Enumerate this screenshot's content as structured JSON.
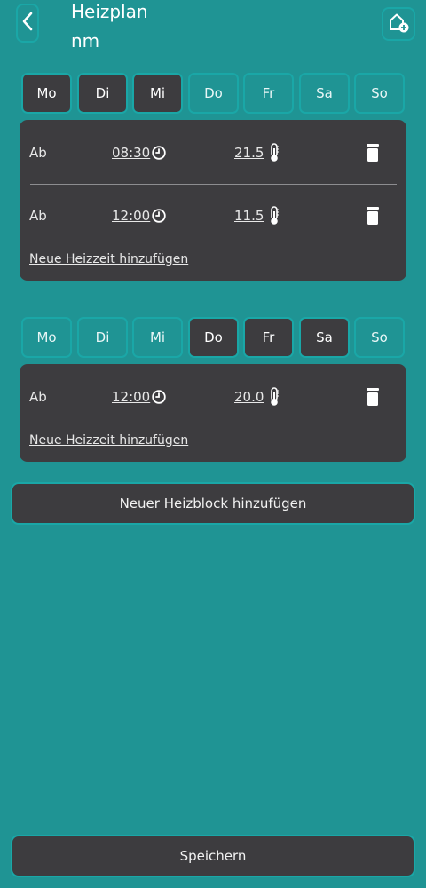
{
  "header": {
    "title": "Heizplan",
    "subtitle": "nm"
  },
  "block1": {
    "days": [
      {
        "label": "Mo",
        "selected": true
      },
      {
        "label": "Di",
        "selected": true
      },
      {
        "label": "Mi",
        "selected": true
      },
      {
        "label": "Do",
        "selected": false
      },
      {
        "label": "Fr",
        "selected": false
      },
      {
        "label": "Sa",
        "selected": false
      },
      {
        "label": "So",
        "selected": false
      }
    ],
    "entries": [
      {
        "prefix": "Ab",
        "time": "08:30",
        "temp": "21.5"
      },
      {
        "prefix": "Ab",
        "time": "12:00",
        "temp": "11.5"
      }
    ],
    "add_label": "Neue Heizzeit hinzufügen"
  },
  "block2": {
    "days": [
      {
        "label": "Mo",
        "selected": false
      },
      {
        "label": "Di",
        "selected": false
      },
      {
        "label": "Mi",
        "selected": false
      },
      {
        "label": "Do",
        "selected": true
      },
      {
        "label": "Fr",
        "selected": true
      },
      {
        "label": "Sa",
        "selected": true
      },
      {
        "label": "So",
        "selected": false
      }
    ],
    "entries": [
      {
        "prefix": "Ab",
        "time": "12:00",
        "temp": "20.0"
      }
    ],
    "add_label": "Neue Heizzeit hinzufügen"
  },
  "add_block_label": "Neuer Heizblock hinzufügen",
  "save_label": "Speichern",
  "icons": {
    "back": "chevron-left-icon",
    "home_add": "home-add-icon",
    "clock": "clock-icon",
    "thermometer": "thermometer-icon",
    "trash": "trash-icon"
  },
  "colors": {
    "background": "#1f9494",
    "card": "#3d3c3f",
    "accent_border": "#1aa7a7",
    "text": "#ffffff"
  }
}
